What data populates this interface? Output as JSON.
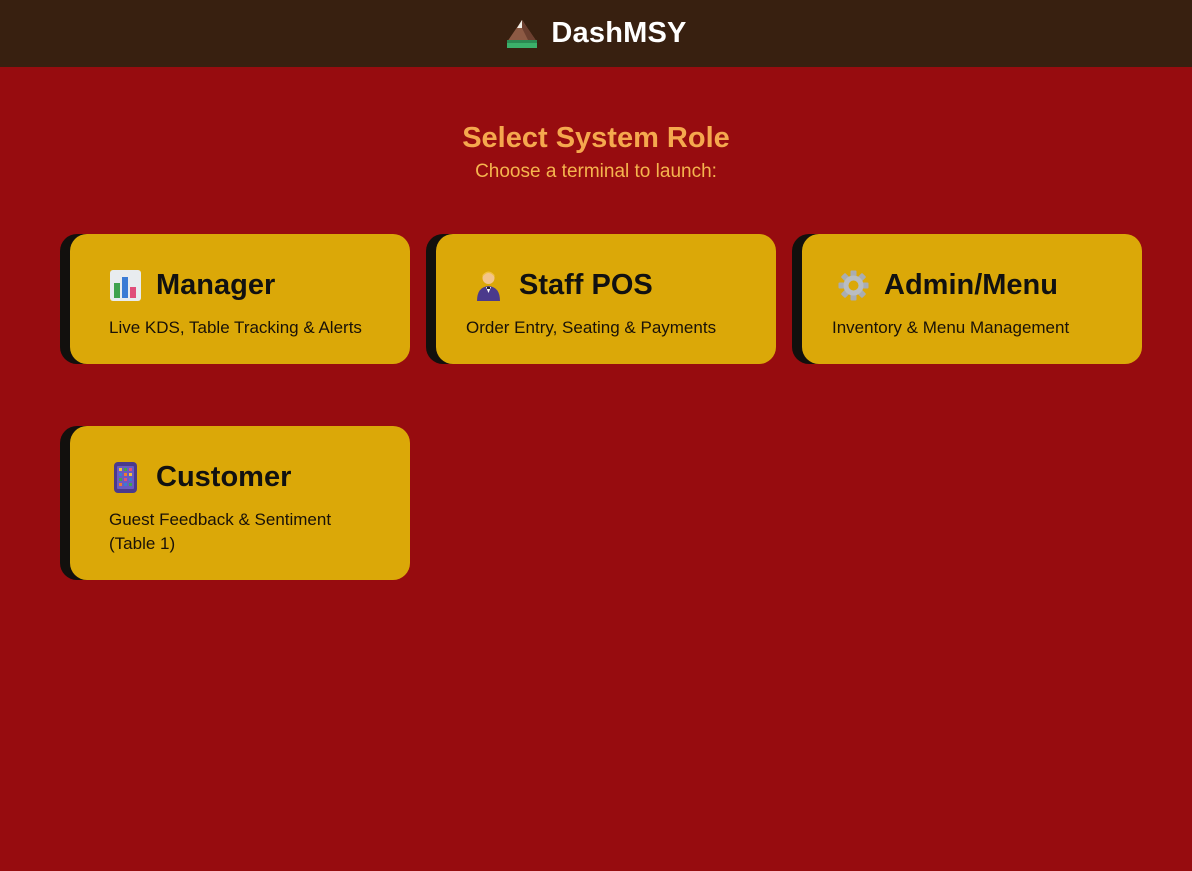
{
  "app": {
    "title": "DashMSY",
    "logo_icon": "mountain-icon"
  },
  "page": {
    "title": "Select System Role",
    "subtitle": "Choose a terminal to launch:"
  },
  "colors": {
    "background": "#970c0f",
    "header": "#382010",
    "card": "#dba808",
    "card_edge": "#12100d",
    "heading": "#f5a84e"
  },
  "roles": [
    {
      "icon": "bar-chart-icon",
      "title": "Manager",
      "description": "Live KDS, Table Tracking & Alerts"
    },
    {
      "icon": "waiter-icon",
      "title": "Staff POS",
      "description": "Order Entry, Seating & Payments"
    },
    {
      "icon": "gear-icon",
      "title": "Admin/Menu",
      "description": "Inventory & Menu Management"
    },
    {
      "icon": "tablet-icon",
      "title": "Customer",
      "description": "Guest Feedback & Sentiment (Table 1)"
    }
  ]
}
